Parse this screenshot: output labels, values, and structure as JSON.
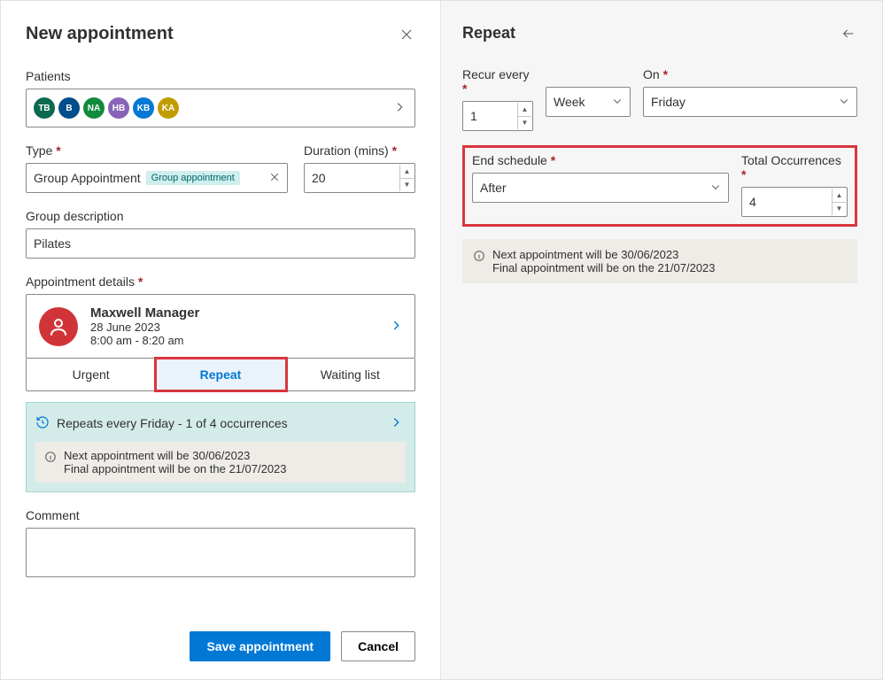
{
  "leftPanel": {
    "title": "New appointment",
    "patientsLabel": "Patients",
    "avatars": [
      {
        "text": "TB",
        "color": "#0b6a4f"
      },
      {
        "text": "B",
        "color": "#004e8c"
      },
      {
        "text": "NA",
        "color": "#118a3c"
      },
      {
        "text": "HB",
        "color": "#8764b8"
      },
      {
        "text": "KB",
        "color": "#0078d4"
      },
      {
        "text": "KA",
        "color": "#c19c00"
      }
    ],
    "typeLabel": "Type",
    "typeValue": "Group Appointment",
    "typeChip": "Group appointment",
    "durationLabel": "Duration (mins)",
    "durationValue": "20",
    "groupDescLabel": "Group description",
    "groupDescValue": "Pilates",
    "apptDetailsLabel": "Appointment details",
    "appt": {
      "name": "Maxwell Manager",
      "date": "28 June 2023",
      "time": "8:00 am - 8:20 am"
    },
    "tabs": {
      "urgent": "Urgent",
      "repeat": "Repeat",
      "waiting": "Waiting list"
    },
    "summary": {
      "line": "Repeats every Friday - 1 of 4 occurrences",
      "info1": "Next appointment will be 30/06/2023",
      "info2": "Final appointment will be on the 21/07/2023"
    },
    "commentLabel": "Comment",
    "saveBtn": "Save appointment",
    "cancelBtn": "Cancel"
  },
  "rightPanel": {
    "title": "Repeat",
    "recurLabel": "Recur every",
    "recurValue": "1",
    "unitValue": "Week",
    "onLabel": "On",
    "onValue": "Friday",
    "endLabel": "End schedule",
    "endValue": "After",
    "occLabel": "Total Occurrences",
    "occValue": "4",
    "info1": "Next appointment will be 30/06/2023",
    "info2": "Final appointment will be on the 21/07/2023"
  }
}
